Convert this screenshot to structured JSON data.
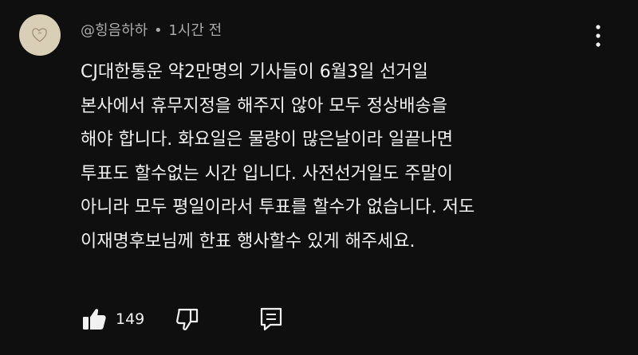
{
  "comment": {
    "author": "@힝음하하",
    "separator": "•",
    "time": "1시간 전",
    "lines": [
      "CJ대한통운 약2만명의 기사들이 6월3일 선거일",
      "본사에서 휴무지정을 해주지 않아 모두 정상배송을",
      "해야 합니다. 화요일은 물량이 많은날이라 일끝나면",
      "투표도 할수없는 시간 입니다. 사전선거일도 주말이",
      "아니라 모두 평일이라서 투표를 할수가 없습니다. 저도",
      "이재명후보님께 한표 행사할수 있게 해주세요."
    ],
    "like_count": "149"
  },
  "icons": {
    "avatar": "heart-doodle-avatar",
    "menu": "kebab-menu-icon",
    "like": "thumbs-up-icon",
    "dislike": "thumbs-down-icon",
    "reply": "reply-comment-icon"
  },
  "colors": {
    "background": "#0f0f0f",
    "text": "#f1f1f1",
    "meta_text": "#aaaaaa",
    "avatar_bg": "#d9cfb7"
  }
}
